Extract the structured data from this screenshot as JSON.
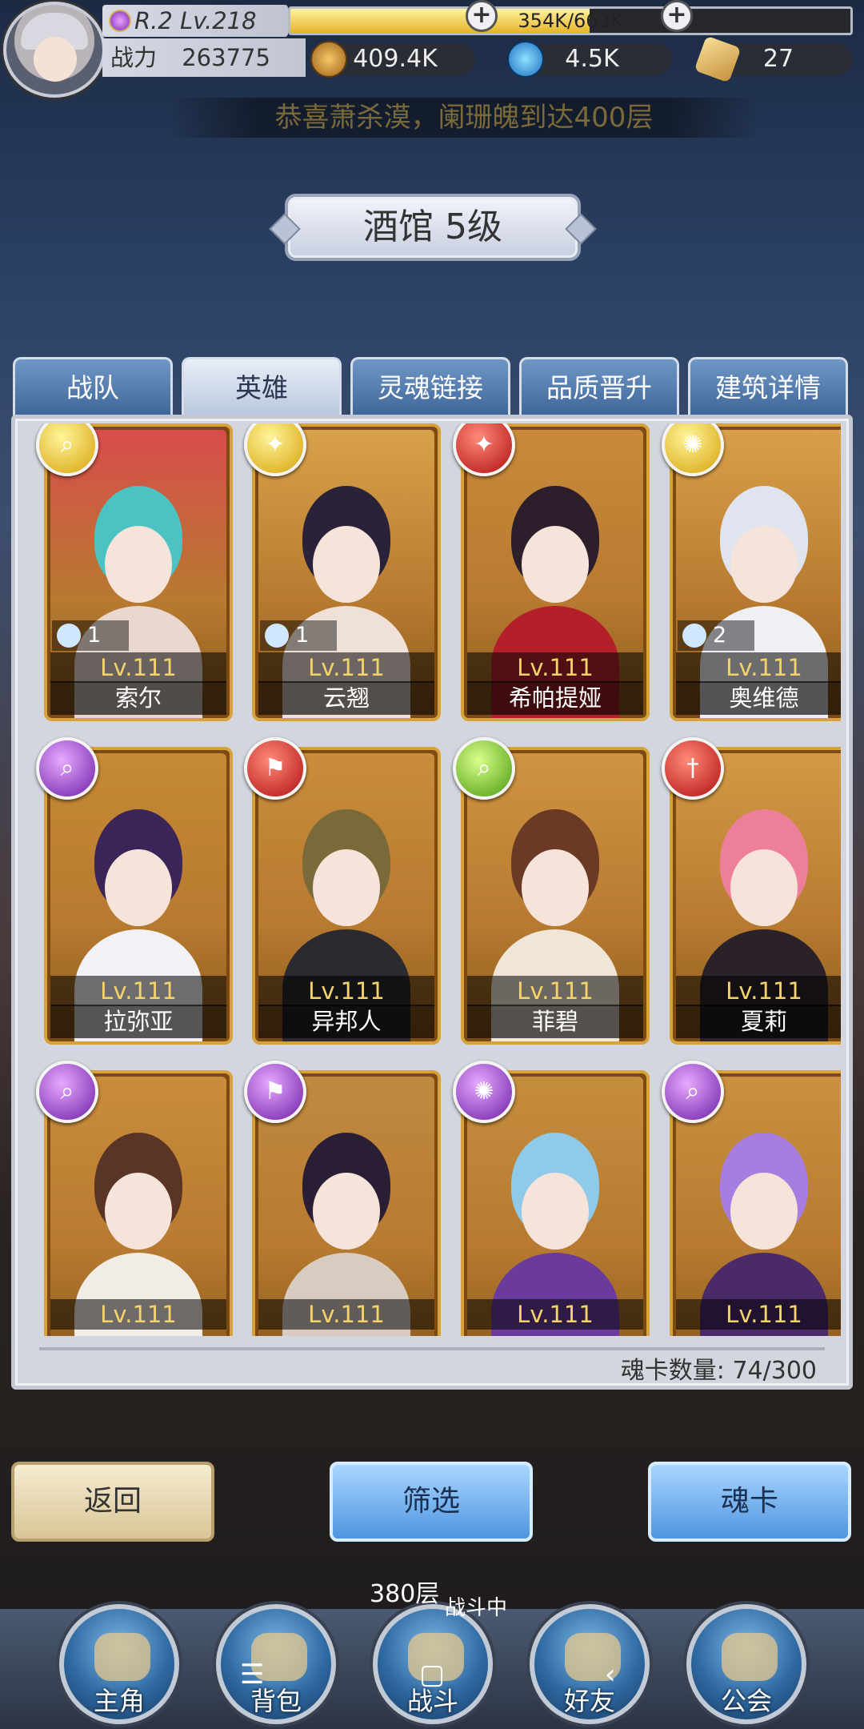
{
  "player": {
    "rank": "R.2 Lv.218",
    "exp_text": "354K/663K",
    "exp_fraction": 0.534,
    "power_label": "战力",
    "power_value": "263775",
    "gold": "409.4K",
    "diamond": "4.5K",
    "scroll": "27"
  },
  "marquee": "恭喜萧杀漠，阑珊魄到达400层",
  "title": "酒馆 5级",
  "tabs": [
    {
      "label": "战队",
      "active": false
    },
    {
      "label": "英雄",
      "active": true
    },
    {
      "label": "灵魂链接",
      "active": false
    },
    {
      "label": "品质晋升",
      "active": false
    },
    {
      "label": "建筑详情",
      "active": false
    }
  ],
  "heroes": [
    {
      "name": "索尔",
      "level": "Lv.111",
      "element": "yellow",
      "element_icon": "magnifier-icon",
      "soul_count": "1",
      "color": "#d94c4c"
    },
    {
      "name": "云翘",
      "level": "Lv.111",
      "element": "yellow",
      "element_icon": "wings-icon",
      "soul_count": "1",
      "color": "#d8a14a"
    },
    {
      "name": "希帕提娅",
      "level": "Lv.111",
      "element": "red",
      "element_icon": "wings-icon",
      "soul_count": "",
      "color": "#c88a3a"
    },
    {
      "name": "奥维德",
      "level": "Lv.111",
      "element": "yellow",
      "element_icon": "triskele-icon",
      "soul_count": "2",
      "color": "#d8a04a"
    },
    {
      "name": "拉弥亚",
      "level": "Lv.111",
      "element": "purple",
      "element_icon": "magnifier-icon",
      "soul_count": "",
      "color": "#c58a34"
    },
    {
      "name": "异邦人",
      "level": "Lv.111",
      "element": "red",
      "element_icon": "flag-icon",
      "soul_count": "",
      "color": "#c98d3c"
    },
    {
      "name": "菲碧",
      "level": "Lv.111",
      "element": "green",
      "element_icon": "magnifier-icon",
      "soul_count": "",
      "color": "#cf9442"
    },
    {
      "name": "夏莉",
      "level": "Lv.111",
      "element": "red",
      "element_icon": "sword-icon",
      "soul_count": "",
      "color": "#d39a45"
    },
    {
      "name": "",
      "level": "Lv.111",
      "element": "purple",
      "element_icon": "magnifier-icon",
      "soul_count": "",
      "color": "#c98d3c"
    },
    {
      "name": "",
      "level": "Lv.111",
      "element": "purple",
      "element_icon": "flag-icon",
      "soul_count": "",
      "color": "#bf8a40"
    },
    {
      "name": "",
      "level": "Lv.111",
      "element": "purple",
      "element_icon": "triskele-icon",
      "soul_count": "",
      "color": "#c58d3e"
    },
    {
      "name": "",
      "level": "Lv.111",
      "element": "purple",
      "element_icon": "magnifier-icon",
      "soul_count": "",
      "color": "#c9913f"
    }
  ],
  "card_count_text": "魂卡数量: 74/300",
  "actions": {
    "back": "返回",
    "filter": "筛选",
    "soul_card": "魂卡"
  },
  "battle": {
    "floor": "380层",
    "status": "战斗中"
  },
  "nav": [
    {
      "label": "主角",
      "icon": "helmet-icon"
    },
    {
      "label": "背包",
      "icon": "backpack-icon"
    },
    {
      "label": "战斗",
      "icon": "crossed-swords-icon"
    },
    {
      "label": "好友",
      "icon": "handshake-icon"
    },
    {
      "label": "公会",
      "icon": "guild-emblem-icon"
    }
  ],
  "system_nav": {
    "menu": "☰",
    "home": "▢",
    "back": "‹"
  }
}
